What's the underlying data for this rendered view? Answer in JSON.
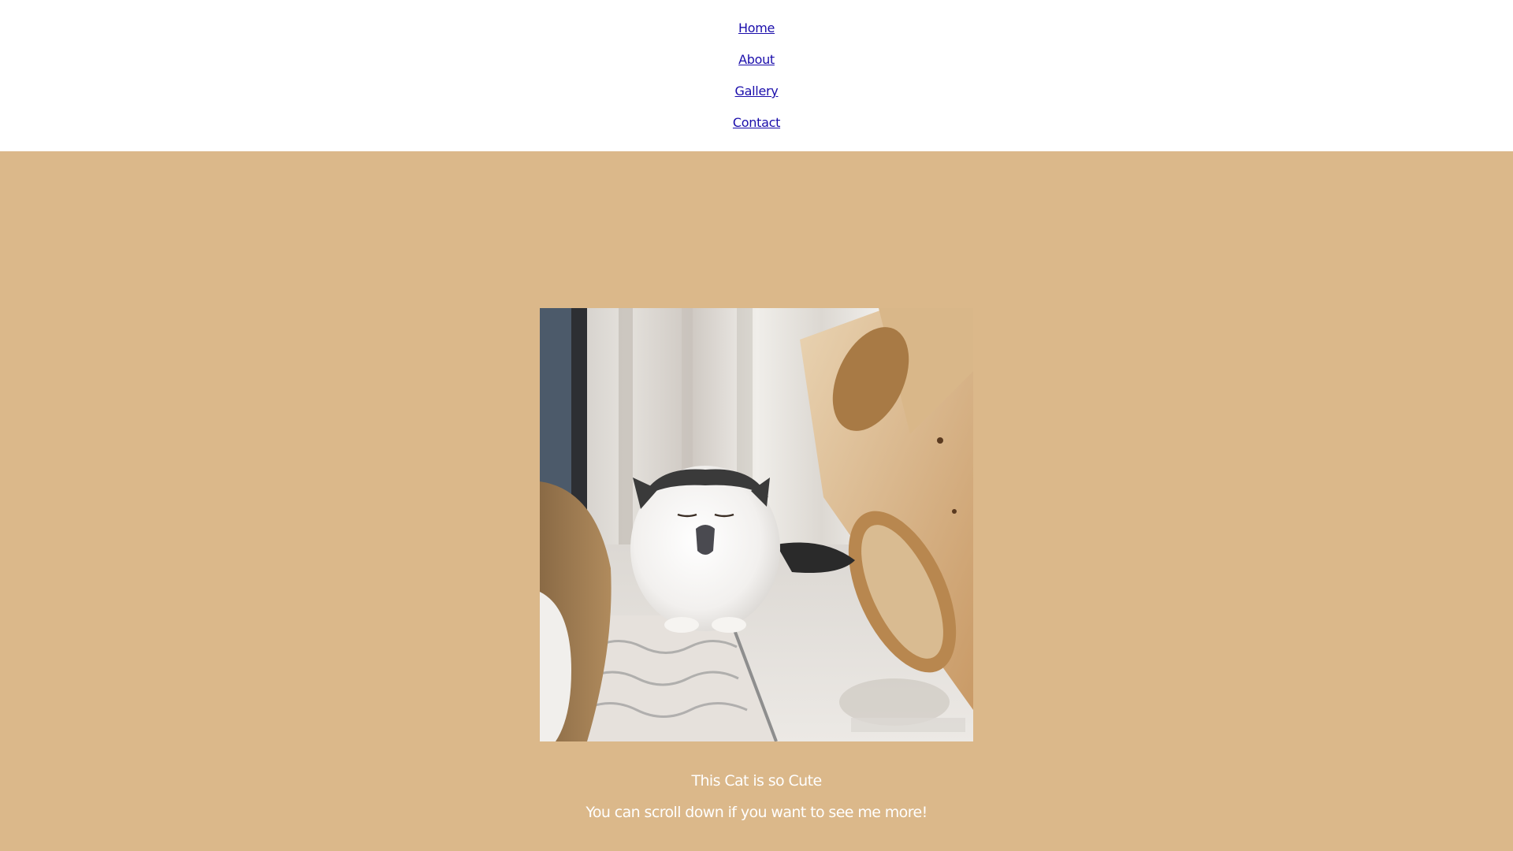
{
  "nav": {
    "items": [
      {
        "label": "Home"
      },
      {
        "label": "About"
      },
      {
        "label": "Gallery"
      },
      {
        "label": "Contact"
      }
    ]
  },
  "hero": {
    "background_color": "#dbb88a",
    "caption_title": "This Cat is so Cute",
    "caption_subtitle": "You can scroll down if you want to see me more!"
  },
  "photo": {
    "subject": "fluffy white and black cat yawning next to a wooden cube"
  }
}
